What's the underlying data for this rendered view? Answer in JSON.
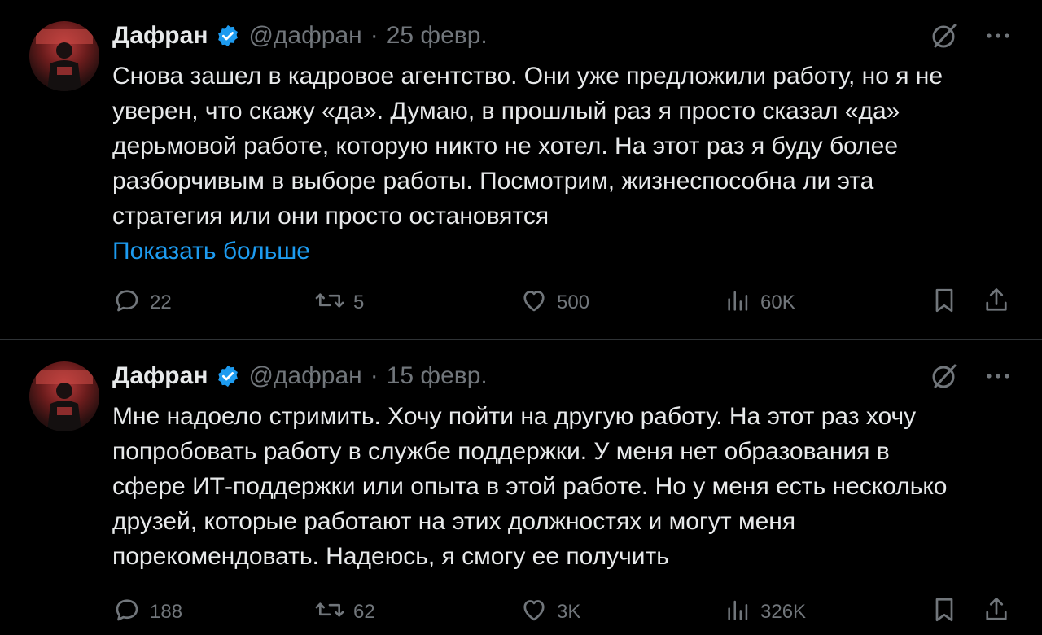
{
  "tweets": [
    {
      "author": "Дафран",
      "handle": "@дафран",
      "separator": "·",
      "date": "25 февр.",
      "lines": [
        "Снова зашел в кадровое агентство. Они уже предложили работу, но я не",
        "уверен, что скажу «да». Думаю, в прошлый раз я просто сказал «да»",
        "дерьмовой работе, которую никто не хотел. На этот раз я буду более",
        "разборчивым в выборе работы. Посмотрим, жизнеспособна ли эта",
        "стратегия или они просто остановятся"
      ],
      "show_more": "Показать больше",
      "replies": "22",
      "reposts": "5",
      "likes": "500",
      "views": "60K"
    },
    {
      "author": "Дафран",
      "handle": "@дафран",
      "separator": "·",
      "date": "15 февр.",
      "lines": [
        "Мне надоело стримить. Хочу пойти на другую работу. На этот раз хочу",
        "попробовать работу в службе поддержки. У меня нет образования в",
        "сфере ИТ-поддержки или опыта в этой работе. Но у меня есть несколько",
        "друзей, которые работают на этих должностях и могут меня",
        "порекомендовать. Надеюсь, я смогу ее получить"
      ],
      "replies": "188",
      "reposts": "62",
      "likes": "3K",
      "views": "326K"
    }
  ],
  "colors": {
    "background": "#000000",
    "text": "#e7e9ea",
    "muted": "#71767b",
    "link": "#1d9bf0",
    "verified": "#1d9bf0",
    "divider": "#2f3336"
  },
  "icons": [
    "grok-icon",
    "more-icon",
    "reply-icon",
    "repost-icon",
    "like-icon",
    "views-icon",
    "bookmark-icon",
    "share-icon",
    "verified-icon"
  ]
}
